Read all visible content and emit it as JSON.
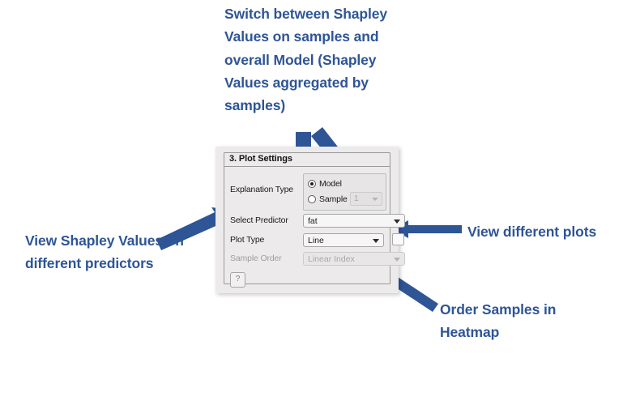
{
  "accent_color": "#2e5596",
  "panel_bg": "#eceaea",
  "callouts": {
    "switch_explanation": "Switch between Shapley Values on samples and overall Model (Shapley Values aggregated by samples)",
    "view_predictors": "View Shapley Values on different predictors",
    "view_plots": "View different plots",
    "order_heatmap": "Order Samples in Heatmap"
  },
  "panel": {
    "title": "3. Plot Settings",
    "explanation_type": {
      "label": "Explanation Type",
      "options": [
        {
          "label": "Model",
          "selected": true
        },
        {
          "label": "Sample",
          "selected": false
        }
      ],
      "sample_index": {
        "value": "1",
        "disabled": true
      }
    },
    "select_predictor": {
      "label": "Select Predictor",
      "value": "fat",
      "disabled": false
    },
    "plot_type": {
      "label": "Plot Type",
      "value": "Line",
      "disabled": false
    },
    "heatmap_order_checkbox": {
      "checked": false
    },
    "sample_order": {
      "label": "Sample Order",
      "value": "Linear Index",
      "disabled": true
    },
    "help_button": {
      "label": "?"
    }
  }
}
